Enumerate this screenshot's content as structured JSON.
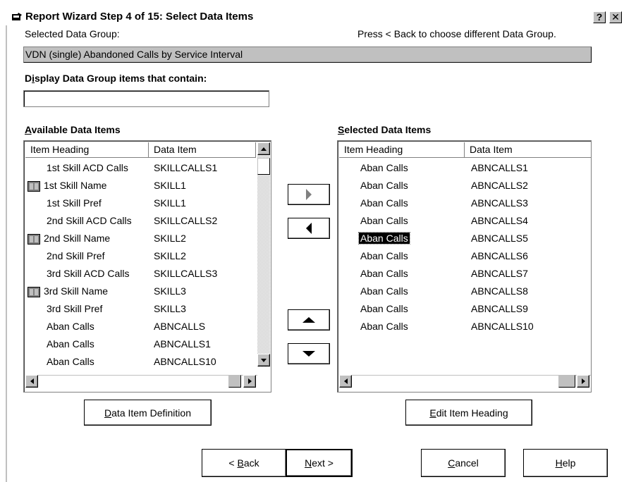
{
  "window": {
    "title": "Report Wizard Step 4 of 15: Select Data Items",
    "help_button": "?",
    "close_button": "✕"
  },
  "data_group": {
    "label": "Selected Data Group:",
    "hint": "Press < Back to choose different Data Group.",
    "value": "VDN (single) Abandoned Calls by Service Interval"
  },
  "filter": {
    "label_pre": "D",
    "label_u": "i",
    "label_post": "splay Data Group items that contain:",
    "value": ""
  },
  "available": {
    "title_u": "A",
    "title_rest": "vailable Data Items",
    "col_heading": "Item Heading",
    "col_item": "Data Item",
    "rows": [
      {
        "heading": "1st Skill ACD Calls",
        "item": "SKILLCALLS1",
        "book_icon": false
      },
      {
        "heading": "1st Skill Name",
        "item": "SKILL1",
        "book_icon": true
      },
      {
        "heading": "1st Skill Pref",
        "item": "SKILL1",
        "book_icon": false
      },
      {
        "heading": "2nd Skill ACD Calls",
        "item": "SKILLCALLS2",
        "book_icon": false
      },
      {
        "heading": "2nd Skill Name",
        "item": "SKILL2",
        "book_icon": true
      },
      {
        "heading": "2nd Skill Pref",
        "item": "SKILL2",
        "book_icon": false
      },
      {
        "heading": "3rd Skill ACD Calls",
        "item": "SKILLCALLS3",
        "book_icon": false
      },
      {
        "heading": "3rd Skill Name",
        "item": "SKILL3",
        "book_icon": true
      },
      {
        "heading": "3rd Skill Pref",
        "item": "SKILL3",
        "book_icon": false
      },
      {
        "heading": "Aban Calls",
        "item": "ABNCALLS",
        "book_icon": false
      },
      {
        "heading": "Aban Calls",
        "item": "ABNCALLS1",
        "book_icon": false
      },
      {
        "heading": "Aban Calls",
        "item": "ABNCALLS10",
        "book_icon": false
      }
    ]
  },
  "selected": {
    "title_u": "S",
    "title_rest": "elected Data Items",
    "col_heading": "Item Heading",
    "col_item": "Data Item",
    "selected_index": 4,
    "rows": [
      {
        "heading": "Aban Calls",
        "item": "ABNCALLS1"
      },
      {
        "heading": "Aban Calls",
        "item": "ABNCALLS2"
      },
      {
        "heading": "Aban Calls",
        "item": "ABNCALLS3"
      },
      {
        "heading": "Aban Calls",
        "item": "ABNCALLS4"
      },
      {
        "heading": "Aban Calls",
        "item": "ABNCALLS5"
      },
      {
        "heading": "Aban Calls",
        "item": "ABNCALLS6"
      },
      {
        "heading": "Aban Calls",
        "item": "ABNCALLS7"
      },
      {
        "heading": "Aban Calls",
        "item": "ABNCALLS8"
      },
      {
        "heading": "Aban Calls",
        "item": "ABNCALLS9"
      },
      {
        "heading": "Aban Calls",
        "item": "ABNCALLS10"
      }
    ]
  },
  "buttons": {
    "definition_u": "D",
    "definition_rest": "ata Item Definition",
    "edit_u": "E",
    "edit_rest": "dit Item Heading",
    "back_pre": "< ",
    "back_u": "B",
    "back_rest": "ack",
    "next_u": "N",
    "next_rest": "ext >",
    "cancel_u": "C",
    "cancel_rest": "ancel",
    "help_u": "H",
    "help_rest": "elp"
  },
  "icons": {
    "title": "wizard-app-icon",
    "row_book": "book-icon"
  }
}
